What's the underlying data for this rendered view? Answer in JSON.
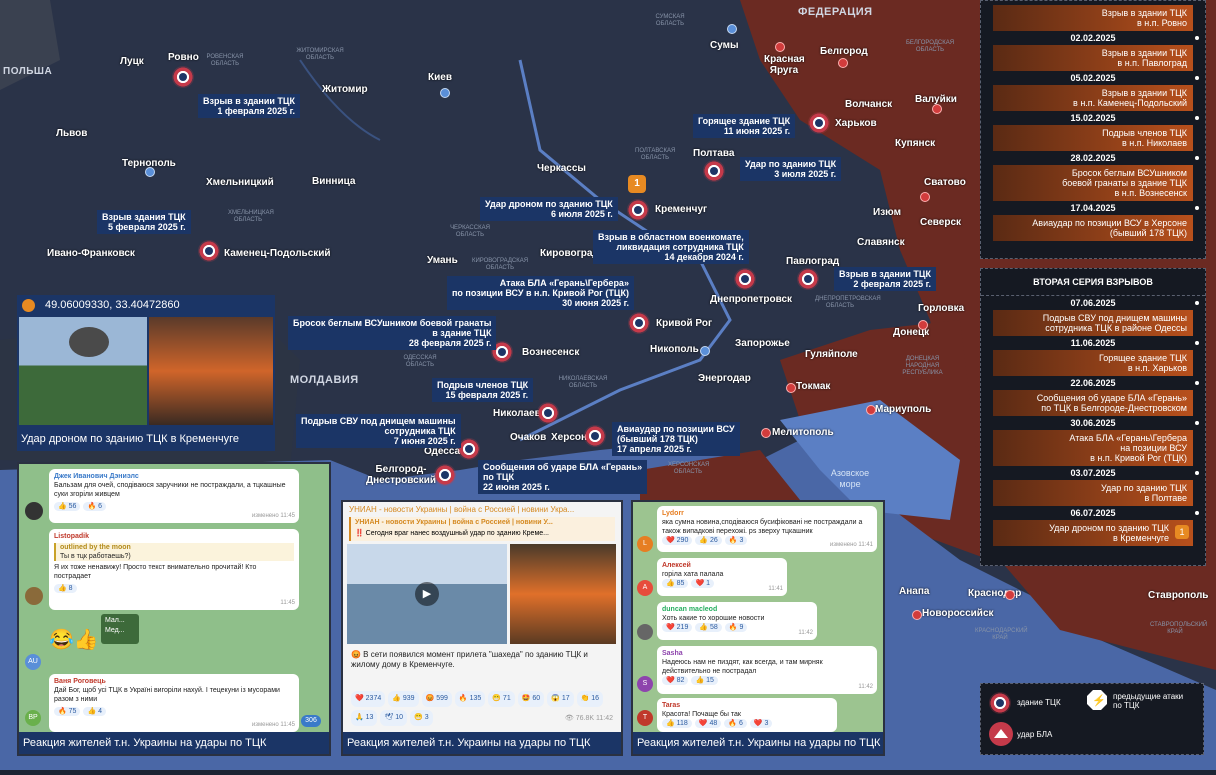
{
  "map": {
    "countries": {
      "russia": "ФЕДЕРАЦИЯ",
      "poland": "ПОЛЬША",
      "moldova": "МОЛДАВИЯ"
    },
    "sea": "Азовское море",
    "cities": [
      "Луцк",
      "Ровно",
      "Житомир",
      "Киев",
      "Сумы",
      "Красная Яруга",
      "Белгород",
      "Валуйки",
      "Волчанск",
      "Харьков",
      "Купянск",
      "Львов",
      "Тернополь",
      "Хмельницкий",
      "Винница",
      "Черкассы",
      "Полтава",
      "Сватово",
      "Кременчуг",
      "Изюм",
      "Северск",
      "Славянск",
      "Ивано-Франковск",
      "Каменец-Подольский",
      "Умань",
      "Кировоград",
      "Днепропетровск",
      "Павлоград",
      "Горловка",
      "Кривой Рог",
      "Вознесенск",
      "Никополь",
      "Запорожье",
      "Донецк",
      "Гуляйполе",
      "Энергодар",
      "Токмак",
      "Николаев",
      "Мариуполь",
      "Херсон",
      "Очаков",
      "Мелитополь",
      "Одесса",
      "Белгород-Днестровский",
      "Анапа",
      "Краснодар",
      "Новороссийск",
      "Ставрополь"
    ],
    "regions": [
      "СУМСКАЯ ОБЛАСТЬ",
      "ЖИТОМИРСКАЯ ОБЛАСТЬ",
      "РОВЕНСКАЯ ОБЛАСТЬ",
      "ПОЛТАВСКАЯ ОБЛАСТЬ",
      "ХМЕЛЬНИЦКАЯ ОБЛАСТЬ",
      "ЧЕРКАССКАЯ ОБЛАСТЬ",
      "КИРОВОГРАДСКАЯ ОБЛАСТЬ",
      "ДНЕПРОПЕТРОВСКАЯ ОБЛАСТЬ",
      "НИКОЛАЕВСКАЯ ОБЛАСТЬ",
      "ХЕРСОНСКАЯ ОБЛАСТЬ",
      "ОДЕССКАЯ ОБЛАСТЬ",
      "ДОНЕЦКАЯ НАРОДНАЯ РЕСПУБЛИКА",
      "БЕЛГОРОДСКАЯ ОБЛАСТЬ",
      "КРАСНОДАРСКИЙ КРАЙ",
      "СТАВРОПОЛЬСКИЙ КРАЙ"
    ],
    "labels": [
      [
        "Взрыв в здании ТЦК",
        "1 февраля 2025 г."
      ],
      [
        "Взрыв здания ТЦК",
        "5 февраля 2025 г."
      ],
      [
        "Горящее здание ТЦК",
        "11 июня 2025 г."
      ],
      [
        "Удар по зданию ТЦК",
        "3 июля 2025 г."
      ],
      [
        "Удар дроном по зданию ТЦК",
        "6 июля 2025 г."
      ],
      [
        "Взрыв в областном военкомате,",
        "ликвидация сотрудника ТЦК",
        "14 декабря 2024 г."
      ],
      [
        "Атака БЛА «Герань\\Гербера»",
        "по позиции ВСУ в н.п. Кривой Рог (ТЦК)",
        "30 июня 2025 г."
      ],
      [
        "Взрыв в здании ТЦК",
        "2 февраля 2025 г."
      ],
      [
        "Бросок беглым ВСУшником боевой гранаты",
        "в здание ТЦК",
        "28 февраля 2025 г."
      ],
      [
        "Подрыв членов ТЦК",
        "15 февраля 2025 г."
      ],
      [
        "Подрыв СВУ под днищем машины",
        "сотрудника ТЦК",
        "7 июня 2025 г."
      ],
      [
        "Авиаудар по позиции ВСУ",
        "(бывший 178 ТЦК)",
        "17 апреля 2025 г."
      ],
      [
        "Сообщения об ударе БЛА «Герань»",
        "по ТЦК",
        "22 июня 2025 г."
      ]
    ],
    "coords_box": "49.06009330, 33.40472860",
    "photo_caption": "Удар дроном по зданию ТЦК в Кременчуге",
    "marker_badge": "1"
  },
  "panel_top": [
    {
      "event": [
        "Взрыв в здании ТЦК",
        "в н.п. Ровно"
      ]
    },
    {
      "date": "02.02.2025",
      "event": [
        "Взрыв в здании ТЦК",
        "в н.п. Павлоград"
      ]
    },
    {
      "date": "05.02.2025",
      "event": [
        "Взрыв в здании ТЦК",
        "в н.п. Каменец-Подольский"
      ]
    },
    {
      "date": "15.02.2025",
      "event": [
        "Подрыв членов ТЦК",
        "в н.п. Николаев"
      ]
    },
    {
      "date": "28.02.2025",
      "event": [
        "Бросок беглым ВСУшником",
        "боевой гранаты в здание ТЦК",
        "в н.п. Вознесенск"
      ]
    },
    {
      "date": "17.04.2025",
      "event": [
        "Авиаудар по позиции ВСУ в Херсоне",
        "(бывший 178 ТЦК)"
      ]
    }
  ],
  "panel_bottom": {
    "title": "ВТОРАЯ СЕРИЯ ВЗРЫВОВ",
    "items": [
      {
        "date": "07.06.2025",
        "event": [
          "Подрыв СВУ под днищем машины",
          "сотрудника ТЦК в районе Одессы"
        ]
      },
      {
        "date": "11.06.2025",
        "event": [
          "Горящее здание ТЦК",
          "в н.п. Харьков"
        ]
      },
      {
        "date": "22.06.2025",
        "event": [
          "Сообщения об ударе БЛА «Герань»",
          "по ТЦК в Белгороде-Днестровском"
        ]
      },
      {
        "date": "30.06.2025",
        "event": [
          "Атака БЛА «Герань\\Гербера",
          "на позиции ВСУ",
          "в н.п. Кривой Рог (ТЦК)"
        ]
      },
      {
        "date": "03.07.2025",
        "event": [
          "Удар по зданию ТЦК",
          "в Полтаве"
        ]
      },
      {
        "date": "06.07.2025",
        "event": [
          "Удар дроном по зданию ТЦК",
          "в Кременчуге"
        ]
      }
    ]
  },
  "chats": {
    "caption": "Реакция жителей т.н. Украины на удары по ТЦК",
    "chat1": {
      "m1": {
        "name": "Джек Иванович Дэниэлс",
        "text": "Бальзам для очей, сподіваюся заручники не постраждали, а тцкашные суки згоріли живцем",
        "r1": "👍 56",
        "r2": "🔥 6",
        "time": "изменено 11:45"
      },
      "m2": {
        "name": "Listopadik",
        "quote_name": "outlined by the moon",
        "quote": "Ты в тцк работаешь?)",
        "text": "Я их тоже ненавижу! Просто текст внимательно прочитай! Кто пострадает",
        "r1": "👍 8",
        "time": "11:45"
      },
      "m3": {
        "text": "Мал...",
        "text2": "Мед..."
      },
      "m4": {
        "name": "Ваня Роговець",
        "text": "Дай Бог, щоб усі ТЦК в Україні вигоріли нахуй. І тецекуни із мусорами разом з ними",
        "r1": "🔥 75",
        "r2": "👍 4",
        "time": "изменено 11:45",
        "badge": "306"
      },
      "av1": "AU",
      "av2": "ВР"
    },
    "chat2": {
      "channel": "УНИАН - новости Украины | война с Россией | новини Укра...",
      "quote_channel": "УНИАН - новости Украины | война с Россией | новини У...",
      "quote": "‼️ Сегодня враг нанес воздушный удар по зданию Креме...",
      "text": "😡 В сети появился момент прилета \"шахеда\" по зданию ТЦК и жилому дому в Кременчуге.",
      "reactions": [
        "❤️ 2374",
        "👍 939",
        "😡 599",
        "🔥 135",
        "😁 71",
        "🤩 60",
        "😱 17",
        "👏 16",
        "🙏 13",
        "🕊 10",
        "😁 3"
      ],
      "views": "👁 76.8K 11:42"
    },
    "chat3": {
      "m1": {
        "name": "Lydorr",
        "text": "яка сумна новина,сподіваюся бусифіковані не постраждали а також випадкові перехожі. ps зверху тцкашник",
        "r": [
          "❤️ 290",
          "👍 26",
          "🔥 3"
        ],
        "time": "изменено 11:41",
        "av": "L"
      },
      "m2": {
        "name": "Алексей",
        "text": "горіла хата палала",
        "r": [
          "👍 85",
          "❤️ 1"
        ],
        "time": "11:41",
        "av": "А"
      },
      "m3": {
        "name": "duncan macleod",
        "text": "Хоть какие то хорошие новости",
        "r": [
          "❤️ 219",
          "👍 58",
          "🔥 9"
        ],
        "time": "11:42"
      },
      "m4": {
        "name": "Sasha",
        "text": "Надеюсь нам не пиздят, как всегда, и там мирняк действительно не пострадал",
        "r": [
          "❤️ 82",
          "👍 15"
        ],
        "time": "11:42",
        "av": "S"
      },
      "m5": {
        "name": "Taras",
        "text": "Красота! Почаще бы так",
        "r": [
          "👍 118",
          "❤️ 48",
          "🔥 6",
          "❤️ 3"
        ],
        "av": "T"
      }
    }
  },
  "legend": {
    "tck": "здание ТЦК",
    "previous": "предыдущие атаки по ТЦК",
    "drone": "удар БЛА"
  },
  "colors": {
    "russia": "#6b2a22",
    "ukraine": "#27324a",
    "sea": "#5b7fc4",
    "label": "#1b3566",
    "accent": "#c53a4a"
  }
}
